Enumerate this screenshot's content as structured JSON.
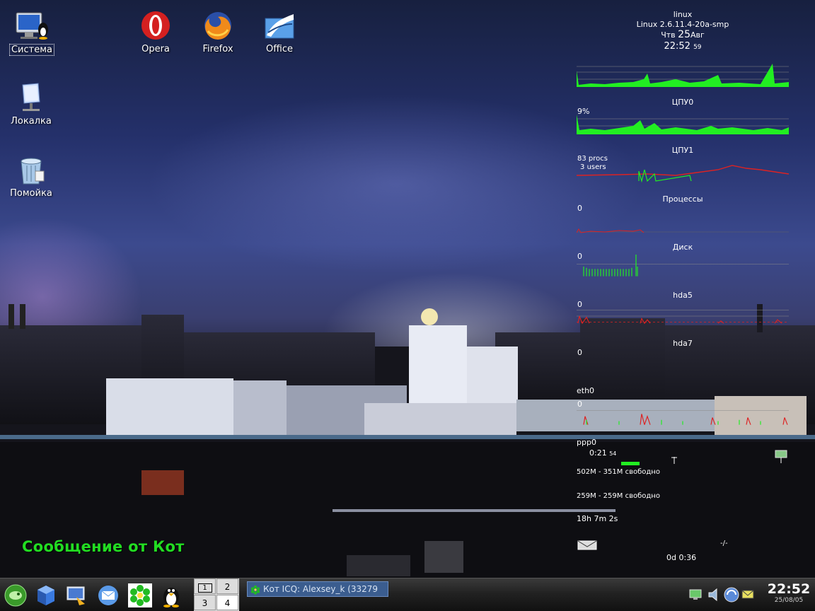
{
  "desktop": {
    "icons": [
      {
        "label": "Система"
      },
      {
        "label": "Opera"
      },
      {
        "label": "Firefox"
      },
      {
        "label": "Office"
      },
      {
        "label": "Локалка"
      },
      {
        "label": "Помойка"
      }
    ]
  },
  "monitor": {
    "hostname": "linux",
    "kernel": "Linux 2.6.11.4-20a-smp",
    "day": "Чтв",
    "date_num": "25",
    "month": "Авг",
    "time": "22:52",
    "seconds": "59",
    "cpu0_label": "ЦПУ0",
    "cpu0_percent": "9%",
    "cpu1_label": "ЦПУ1",
    "procs": "83",
    "procs_word": "procs",
    "users": "3",
    "users_word": "users",
    "proc_label": "Процессы",
    "disk_zero": "0",
    "disk_label": "Диск",
    "hda5_zero": "0",
    "hda5_label": "hda5",
    "hda7_zero": "0",
    "hda7_label": "hda7",
    "eth0_zero": "0",
    "eth0_label": "eth0",
    "ppp0_zero": "0",
    "ppp0_label": "ppp0",
    "ppp0_timer": "0:21",
    "ppp0_timer_sec": "54",
    "mem": "502M - 351M свободно",
    "swap": "259M - 259M свободно",
    "uptime": "18h 7m 2s",
    "mail_sep": "-/-",
    "session": "0d  0:36"
  },
  "notification": {
    "text": "Сообщение от Кот"
  },
  "panel": {
    "pager": [
      "1",
      "2",
      "3",
      "4"
    ],
    "task_label": "Кот ICQ: Alexsey_k (33279",
    "clock_time": "22:52",
    "clock_date": "25/08/05"
  },
  "colors": {
    "graph": "#22ee22",
    "graph_red": "#dd2222",
    "notify": "#22dd22"
  }
}
